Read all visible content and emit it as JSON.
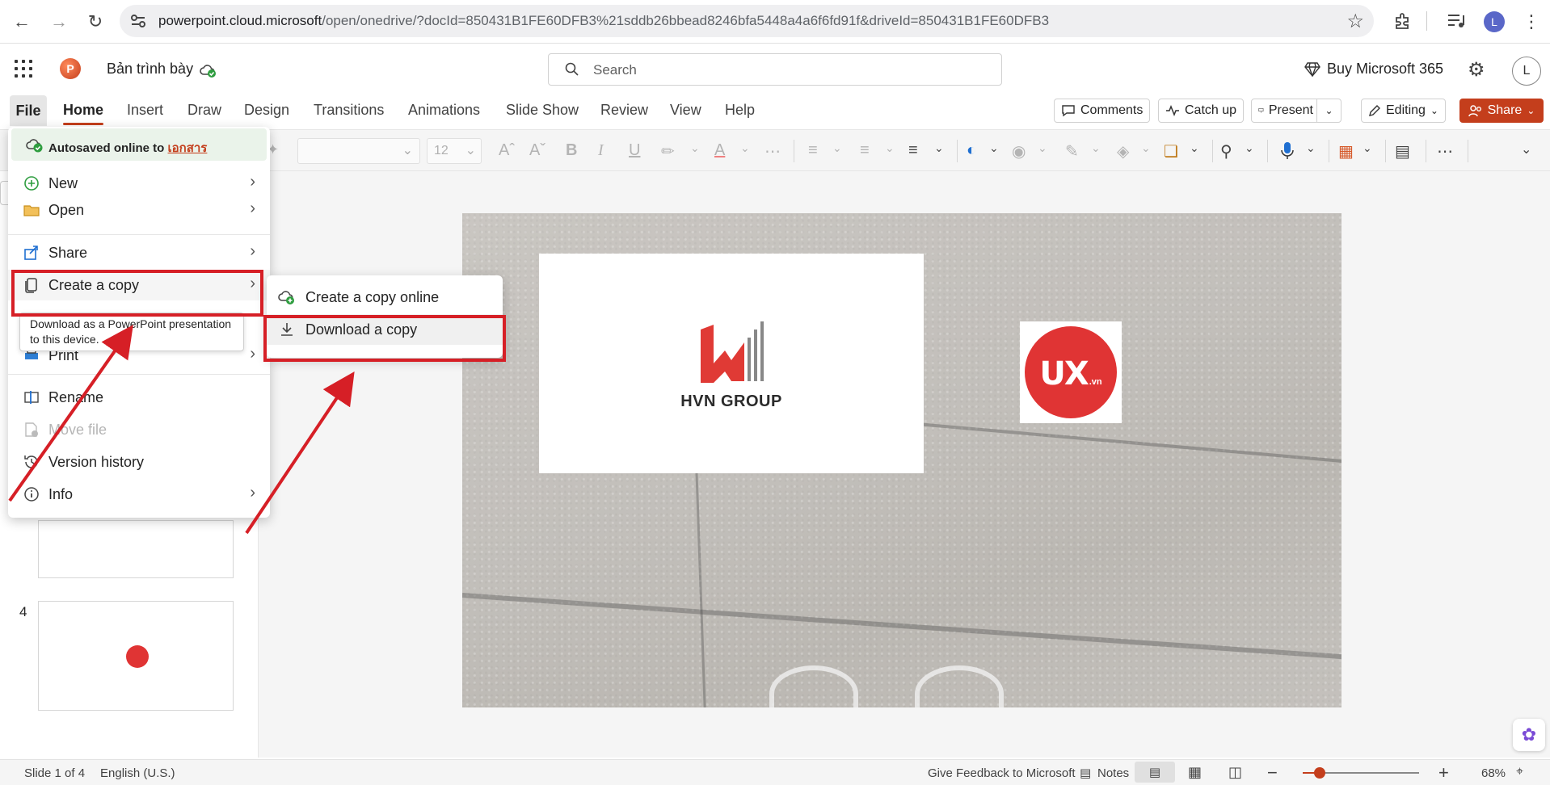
{
  "browser": {
    "url_host": "powerpoint.cloud.microsoft",
    "url_path": "/open/onedrive/?docId=850431B1FE60DFB3%21sddb26bbead8246bfa5448a4a6f6fd91f&driveId=850431B1FE60DFB3",
    "profile_initial": "L"
  },
  "app": {
    "title": "Bản trình bày",
    "search_placeholder": "Search",
    "buy_label": "Buy Microsoft 365",
    "user_initial": "L"
  },
  "ribbon": {
    "tabs": [
      "File",
      "Home",
      "Insert",
      "Draw",
      "Design",
      "Transitions",
      "Animations",
      "Slide Show",
      "Review",
      "View",
      "Help"
    ],
    "comments_label": "Comments",
    "catchup_label": "Catch up",
    "present_label": "Present",
    "editing_label": "Editing",
    "share_label": "Share",
    "font_size": "12"
  },
  "file_menu": {
    "autosave_text": "Autosaved online to",
    "autosave_location": "เอกสาร",
    "items": [
      {
        "label": "New",
        "icon": "plus-circle-icon"
      },
      {
        "label": "Open",
        "icon": "folder-icon"
      },
      {
        "label": "Share",
        "icon": "share-icon"
      },
      {
        "label": "Create a copy",
        "icon": "copy-icon"
      },
      {
        "label": "Print",
        "icon": "printer-icon"
      },
      {
        "label": "Rename",
        "icon": "rename-icon"
      },
      {
        "label": "Move file",
        "icon": "move-file-icon"
      },
      {
        "label": "Version history",
        "icon": "history-icon"
      },
      {
        "label": "Info",
        "icon": "info-icon"
      }
    ],
    "tooltip": "Download as a PowerPoint presentation to this device."
  },
  "submenu": {
    "items": [
      {
        "label": "Create a copy online",
        "icon": "cloud-add-icon"
      },
      {
        "label": "Download a copy",
        "icon": "download-icon"
      }
    ]
  },
  "thumbnails": {
    "slide4_number": "4"
  },
  "slide": {
    "hvn_text": "HVN GROUP",
    "ux_text": "UX",
    "ux_suffix": ".vn"
  },
  "status": {
    "slide_info": "Slide 1 of 4",
    "language": "English (U.S.)",
    "feedback": "Give Feedback to Microsoft",
    "notes": "Notes",
    "zoom": "68%"
  },
  "colors": {
    "accent": "#c43e1c",
    "highlight": "#d61f26"
  }
}
